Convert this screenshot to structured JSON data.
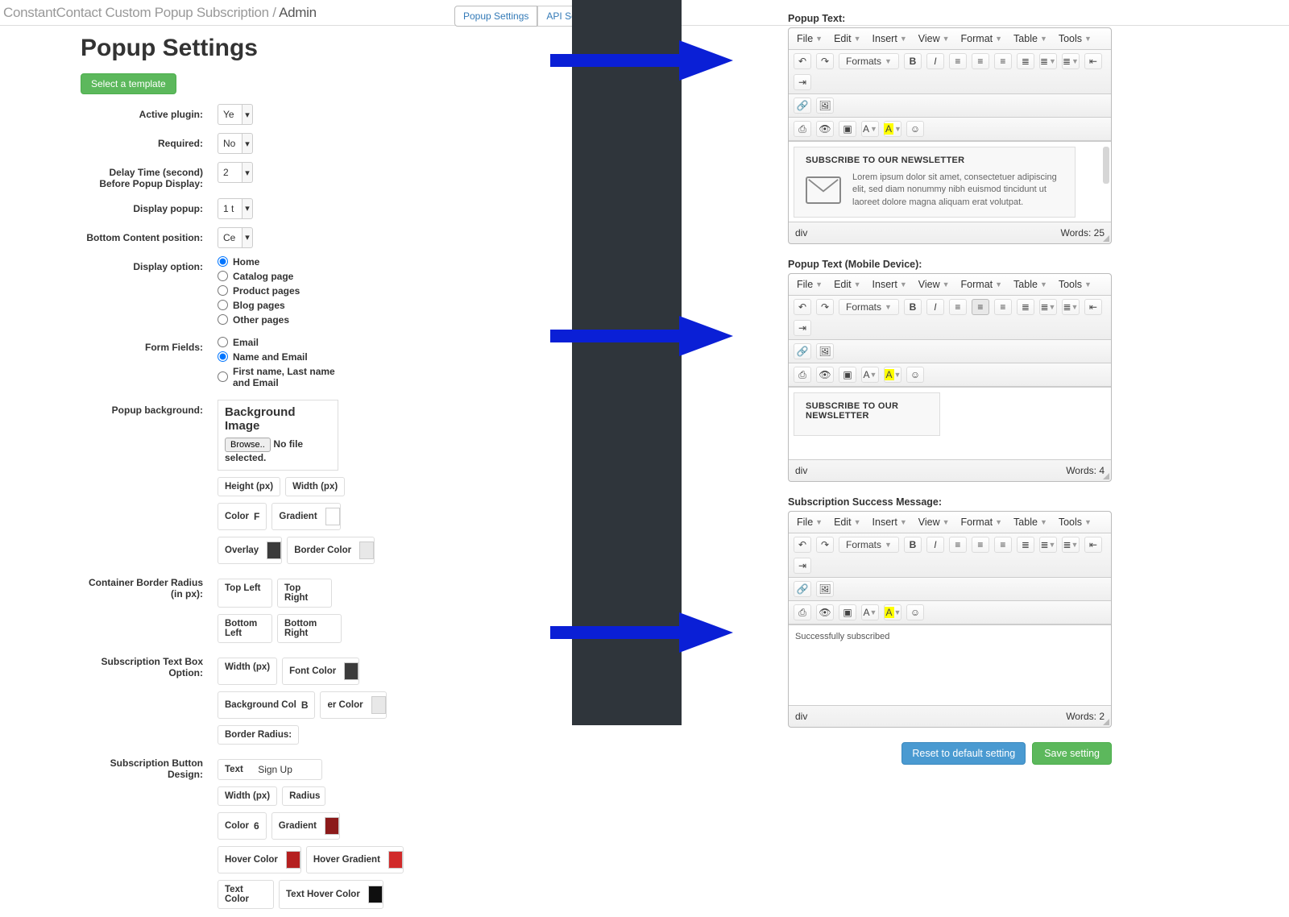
{
  "header": {
    "breadcrumb_part1": "ConstantContact Custom Popup Subscription / ",
    "breadcrumb_current": "Admin",
    "tab_popup": "Popup Settings",
    "tab_api": "API Settings"
  },
  "left": {
    "title": "Popup Settings",
    "select_template_btn": "Select a template",
    "labels": {
      "active": "Active plugin:",
      "required": "Required:",
      "delay": "Delay Time (second) Before Popup Display:",
      "display_popup": "Display popup:",
      "bottom_pos": "Bottom Content position:",
      "display_option": "Display option:",
      "form_fields": "Form Fields:",
      "popup_bg": "Popup background:",
      "border_radius": "Container Border Radius (in px):",
      "textbox_opt": "Subscription Text Box Option:",
      "button_design": "Subscription Button Design:"
    },
    "selects": {
      "active": "Ye",
      "required": "No",
      "delay": "2",
      "display_popup": "1 t",
      "bottom_pos": "Ce"
    },
    "display_options": [
      "Home",
      "Catalog page",
      "Product pages",
      "Blog pages",
      "Other pages"
    ],
    "display_option_selected": 0,
    "form_fields": [
      "Email",
      "Name and Email",
      "First name, Last name and Email"
    ],
    "form_fields_selected": 1,
    "bg_box": {
      "title": "Background Image",
      "browse": "Browse..",
      "no_file": "No file selected."
    },
    "chips": {
      "height_px": "Height (px)",
      "width_px": "Width (px)",
      "color": "Color",
      "color_val": "F",
      "gradient": "Gradient",
      "overlay": "Overlay",
      "border_color": "Border Color",
      "top_left": "Top Left",
      "top_right": "Top Right",
      "bottom_left": "Bottom Left",
      "bottom_right": "Bottom Right",
      "font_color": "Font Color",
      "bg_col": "Background Col",
      "b_prefix": "B",
      "er_color": "er Color",
      "border_radius_chip": "Border Radius:",
      "text": "Text",
      "sign_up": "Sign Up",
      "radius": "Radius",
      "btn_color_val": "6",
      "hover_color": "Hover Color",
      "hover_gradient": "Hover Gradient",
      "text_color": "Text Color",
      "text_hover_color": "Text Hover Color"
    },
    "swatch_colors": {
      "gradient1": "#ffffff",
      "overlay": "#3b3b3b",
      "border_color": "#e8e8e8",
      "font_color": "#3b3b3b",
      "er_color": "#e8e8e8",
      "btn_gradient": "#8c1a1a",
      "hover_color": "#b52020",
      "hover_gradient": "#d12a2a",
      "text_hover": "#0f0f0f"
    }
  },
  "right": {
    "editor1_label": "Popup Text:",
    "editor2_label": "Popup Text (Mobile Device):",
    "editor3_label": "Subscription Success Message:",
    "menus": [
      "File",
      "Edit",
      "Insert",
      "View",
      "Format",
      "Table",
      "Tools"
    ],
    "formats_btn": "Formats",
    "newsletter_head": "SUBSCRIBE TO OUR NEWSLETTER",
    "newsletter_body": "Lorem ipsum dolor sit amet, consectetuer adipiscing elit, sed diam nonummy nibh euismod tincidunt ut laoreet dolore magna aliquam erat volutpat.",
    "status_path": "div",
    "words_prefix": "Words: ",
    "editor1_words": "25",
    "editor2_words": "4",
    "editor3_words": "2",
    "success_text": "Successfully subscribed",
    "reset_btn": "Reset to default setting",
    "save_btn": "Save setting"
  }
}
